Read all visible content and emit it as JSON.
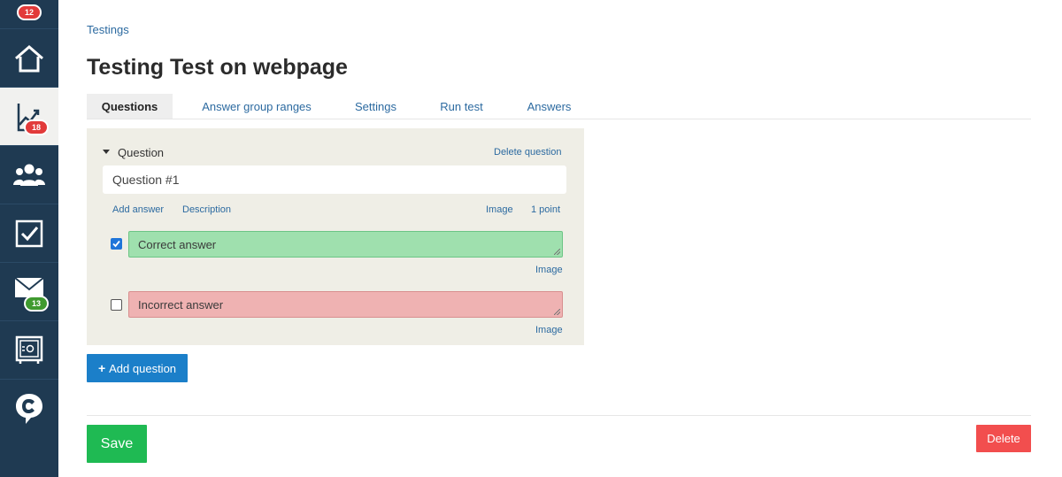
{
  "sidebar": {
    "badges": {
      "top": "12",
      "analytics": "18",
      "mail": "13"
    },
    "items": [
      {
        "name": "home",
        "icon": "home-icon"
      },
      {
        "name": "analytics",
        "icon": "chart-line-icon",
        "active": true
      },
      {
        "name": "users",
        "icon": "users-icon"
      },
      {
        "name": "tasks",
        "icon": "checkbox-icon"
      },
      {
        "name": "mail",
        "icon": "envelope-icon"
      },
      {
        "name": "safe",
        "icon": "safe-icon"
      },
      {
        "name": "chat",
        "icon": "chat-logo-icon"
      }
    ],
    "colors": {
      "bg": "#1f3a52",
      "active_bg": "#f1f1ef",
      "badge_red": "#e23a3a",
      "badge_green": "#3f9a2f"
    }
  },
  "breadcrumb": "Testings",
  "title": "Testing Test on webpage",
  "tabs": [
    {
      "label": "Questions",
      "active": true
    },
    {
      "label": "Answer group ranges"
    },
    {
      "label": "Settings"
    },
    {
      "label": "Run test"
    },
    {
      "label": "Answers"
    }
  ],
  "question": {
    "section_label": "Question",
    "delete_label": "Delete question",
    "value": "Question #1",
    "links": {
      "add_answer": "Add answer",
      "description": "Description",
      "image": "Image",
      "points": "1 point"
    },
    "answers": [
      {
        "text": "Correct answer",
        "checked": true,
        "image_label": "Image"
      },
      {
        "text": "Incorrect answer",
        "checked": false,
        "image_label": "Image"
      }
    ]
  },
  "buttons": {
    "add_question": "Add question",
    "save": "Save",
    "delete": "Delete"
  },
  "colors": {
    "link": "#2c6aa0",
    "panel_bg": "#efeee6",
    "correct_bg": "#9fe0ae",
    "incorrect_bg": "#efb2b2",
    "primary": "#1b7fc9",
    "success": "#1fba53",
    "danger": "#f24e4e"
  }
}
